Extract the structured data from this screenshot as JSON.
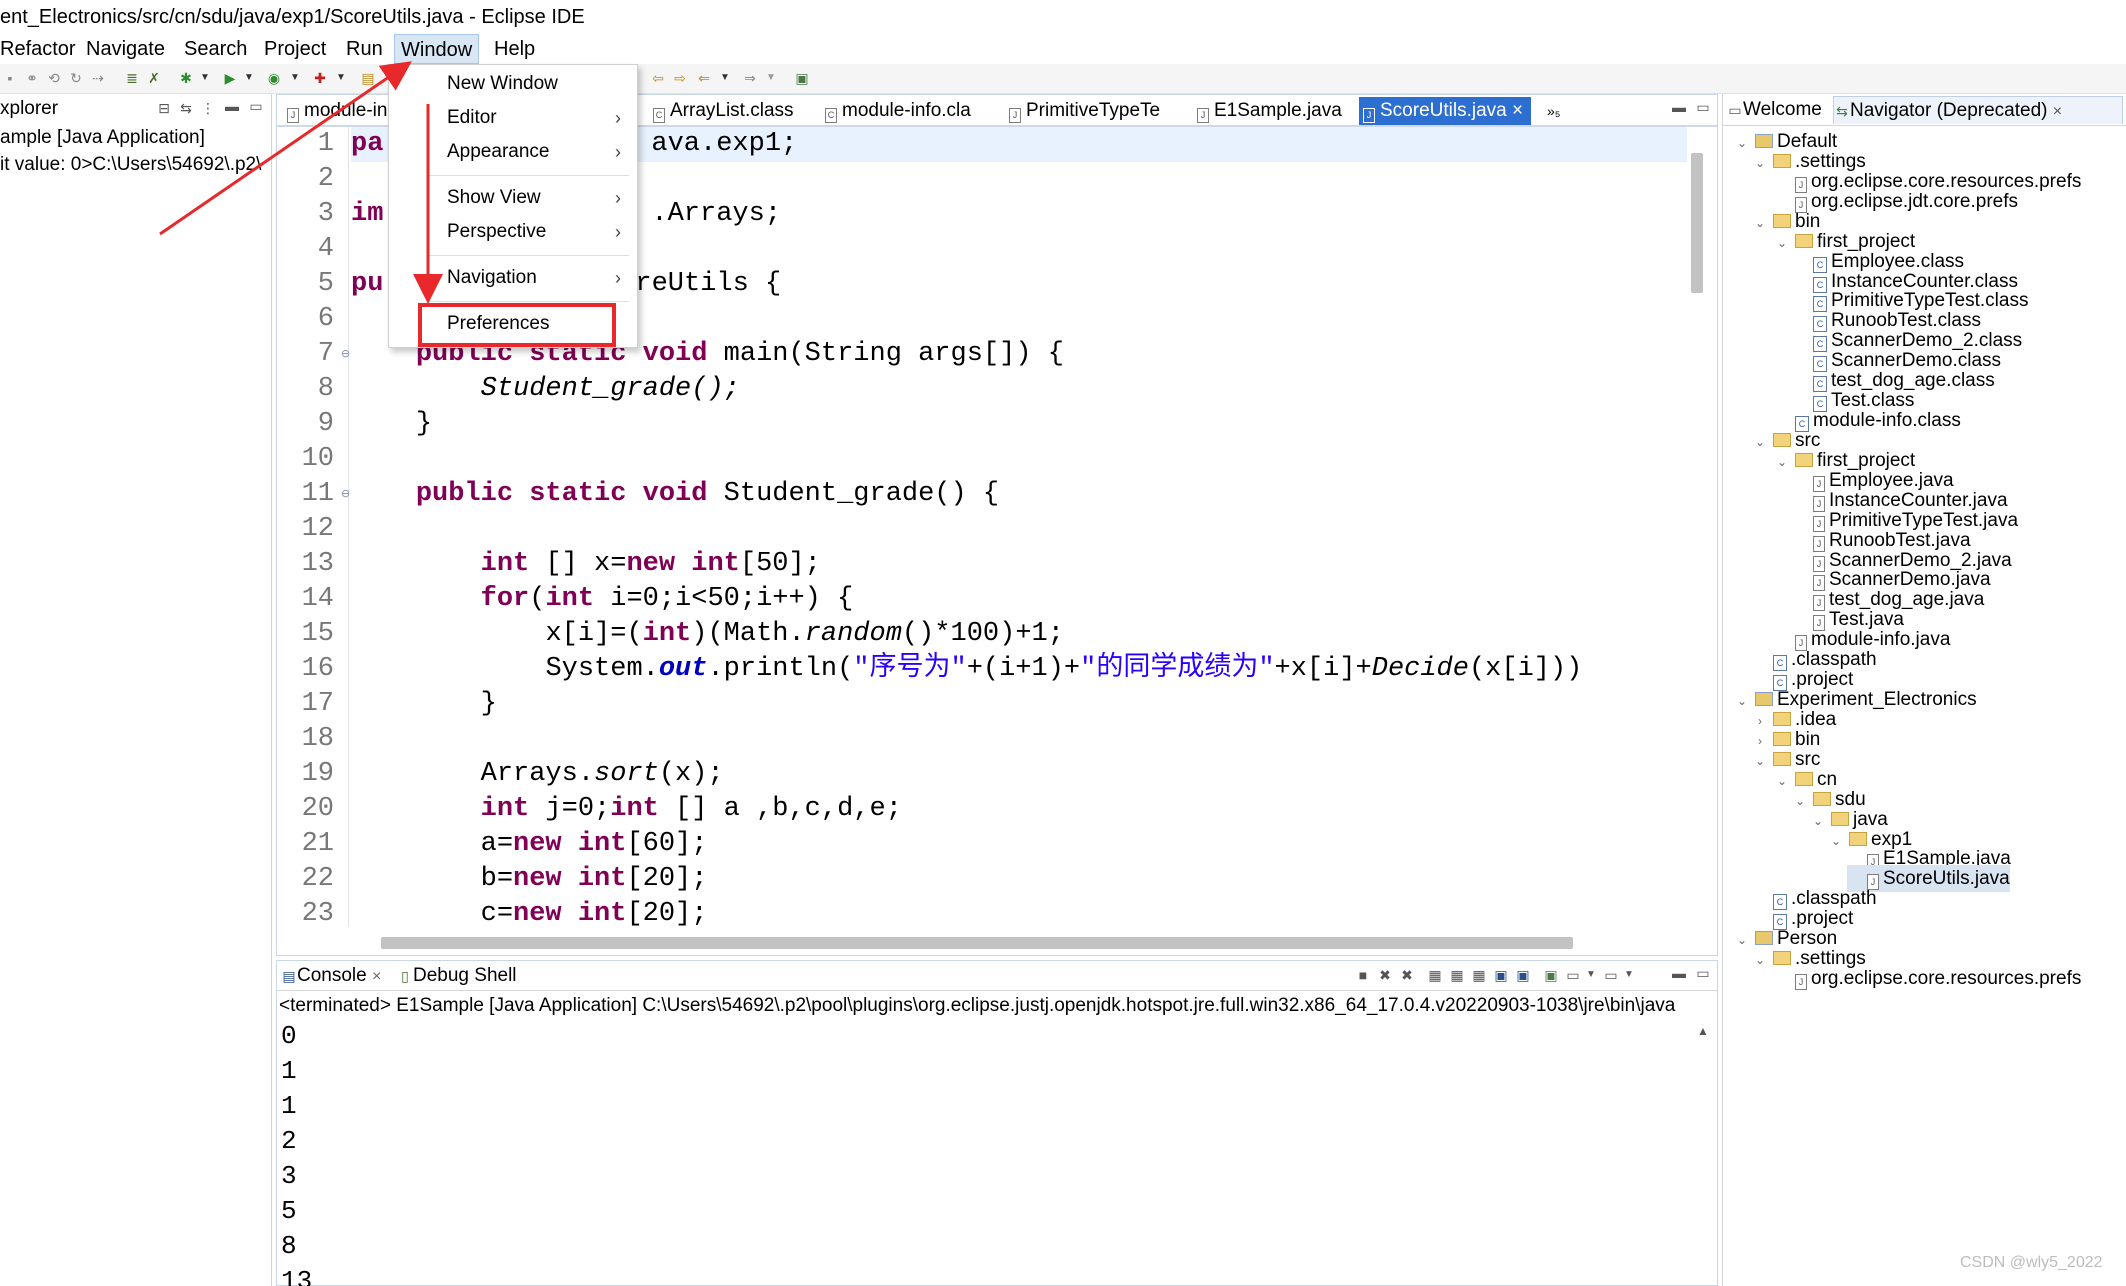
{
  "window": {
    "title": "ent_Electronics/src/cn/sdu/java/exp1/ScoreUtils.java - Eclipse IDE"
  },
  "menubar": {
    "items": [
      "Refactor",
      "Navigate",
      "Search",
      "Project",
      "Run",
      "Window",
      "Help"
    ],
    "active": "Window"
  },
  "window_menu": {
    "items": [
      {
        "label": "New Window",
        "chevron": ""
      },
      {
        "label": "Editor",
        "chevron": "›"
      },
      {
        "label": "Appearance",
        "chevron": "›"
      },
      {
        "label": "Show View",
        "chevron": "›"
      },
      {
        "label": "Perspective",
        "chevron": "›"
      },
      {
        "label": "Navigation",
        "chevron": "›"
      },
      {
        "label": "Preferences",
        "chevron": ""
      }
    ],
    "highlighted": "Preferences"
  },
  "left_pane": {
    "title": "xplorer",
    "rows": [
      "ample [Java Application]",
      "it value: 0>C:\\Users\\54692\\.p2\\"
    ]
  },
  "editor": {
    "tabs": [
      {
        "label": "module-in",
        "icon": "J",
        "active": false
      },
      {
        "label": "ArrayList.class",
        "icon": "C",
        "active": false
      },
      {
        "label": "module-info.cla",
        "icon": "C",
        "active": false
      },
      {
        "label": "PrimitiveTypeTe",
        "icon": "J",
        "active": false
      },
      {
        "label": "E1Sample.java",
        "icon": "J",
        "active": false
      },
      {
        "label": "ScoreUtils.java",
        "icon": "J",
        "active": true
      }
    ],
    "overflow_label": "»₅",
    "close_glyph": "×",
    "line_numbers": [
      "1",
      "2",
      "3",
      "4",
      "5",
      "6",
      "7",
      "8",
      "9",
      "10",
      "11",
      "12",
      "13",
      "14",
      "15",
      "16",
      "17",
      "18",
      "19",
      "20",
      "21",
      "22",
      "23"
    ],
    "lines": {
      "l1": {
        "kw": "pa",
        "rest": "ava.exp1;"
      },
      "l3": {
        "kw": "im",
        "rest": ".Arrays;"
      },
      "l5": {
        "kw": "pu",
        "rest": "reUtils {"
      },
      "l7": {
        "kw": "public static void",
        "rest": " main(String args[]) {"
      },
      "l8": "Student_grade();",
      "l9": "}",
      "l11": {
        "kw": "public static void",
        "rest": " Student_grade() {"
      },
      "l13": {
        "kw1": "int",
        "m1": " [] x=",
        "kw2": "new",
        "m2": " ",
        "kw3": "int",
        "rest": "[50];"
      },
      "l14": {
        "kw1": "for",
        "m1": "(",
        "kw2": "int",
        "rest": " i=0;i<50;i++) {"
      },
      "l15": {
        "a": "x[i]=(",
        "kw": "int",
        "b": ")(Math.",
        "it": "random",
        "c": "()*100)+1;"
      },
      "l16": {
        "a": "System.",
        "fld": "out",
        "b": ".println(",
        "s1": "\"序号为\"",
        "c": "+(i+1)+",
        "s2": "\"的同学成绩为\"",
        "d": "+x[i]+",
        "it": "Decide",
        "e": "(x[i]))"
      },
      "l17": "}",
      "l19": {
        "a": "Arrays.",
        "it": "sort",
        "b": "(x);"
      },
      "l20": {
        "kw1": "int",
        "m1": " j=0;",
        "kw2": "int",
        "rest": " [] a ,b,c,d,e;"
      },
      "l21": {
        "a": "a=",
        "kw1": "new",
        "m": " ",
        "kw2": "int",
        "rest": "[60];"
      },
      "l22": {
        "a": "b=",
        "kw1": "new",
        "m": " ",
        "kw2": "int",
        "rest": "[20];"
      },
      "l23": {
        "a": "c=",
        "kw1": "new",
        "m": " ",
        "kw2": "int",
        "rest": "[20];"
      }
    }
  },
  "console": {
    "tabs": [
      "Console",
      "Debug Shell"
    ],
    "close_glyph": "×",
    "terminated": "<terminated> E1Sample [Java Application] C:\\Users\\54692\\.p2\\pool\\plugins\\org.eclipse.justj.openjdk.hotspot.jre.full.win32.x86_64_17.0.4.v20220903-1038\\jre\\bin\\java",
    "output": [
      "0",
      "1",
      "1",
      "2",
      "3",
      "5",
      "8",
      "13"
    ]
  },
  "navigator": {
    "tabs": [
      "Welcome",
      "Navigator (Deprecated)"
    ],
    "close_glyph": "×",
    "tree": [
      {
        "label": "Default",
        "arrow": "⌄",
        "icon": "proj"
      },
      {
        "label": ".settings",
        "arrow": "⌄",
        "icon": "folder"
      },
      {
        "label": "org.eclipse.core.resources.prefs",
        "arrow": "",
        "icon": "file"
      },
      {
        "label": "org.eclipse.jdt.core.prefs",
        "arrow": "",
        "icon": "file"
      },
      {
        "label": "bin",
        "arrow": "⌄",
        "icon": "folder"
      },
      {
        "label": "first_project",
        "arrow": "⌄",
        "icon": "folder"
      },
      {
        "label": "Employee.class",
        "arrow": "",
        "icon": "cls"
      },
      {
        "label": "InstanceCounter.class",
        "arrow": "",
        "icon": "cls"
      },
      {
        "label": "PrimitiveTypeTest.class",
        "arrow": "",
        "icon": "cls"
      },
      {
        "label": "RunoobTest.class",
        "arrow": "",
        "icon": "cls"
      },
      {
        "label": "ScannerDemo_2.class",
        "arrow": "",
        "icon": "cls"
      },
      {
        "label": "ScannerDemo.class",
        "arrow": "",
        "icon": "cls"
      },
      {
        "label": "test_dog_age.class",
        "arrow": "",
        "icon": "cls"
      },
      {
        "label": "Test.class",
        "arrow": "",
        "icon": "cls"
      },
      {
        "label": "module-info.class",
        "arrow": "",
        "icon": "cls"
      },
      {
        "label": "src",
        "arrow": "⌄",
        "icon": "folder"
      },
      {
        "label": "first_project",
        "arrow": "⌄",
        "icon": "folder"
      },
      {
        "label": "Employee.java",
        "arrow": "",
        "icon": "file"
      },
      {
        "label": "InstanceCounter.java",
        "arrow": "",
        "icon": "file"
      },
      {
        "label": "PrimitiveTypeTest.java",
        "arrow": "",
        "icon": "file"
      },
      {
        "label": "RunoobTest.java",
        "arrow": "",
        "icon": "file"
      },
      {
        "label": "ScannerDemo_2.java",
        "arrow": "",
        "icon": "file"
      },
      {
        "label": "ScannerDemo.java",
        "arrow": "",
        "icon": "file"
      },
      {
        "label": "test_dog_age.java",
        "arrow": "",
        "icon": "file"
      },
      {
        "label": "Test.java",
        "arrow": "",
        "icon": "file"
      },
      {
        "label": "module-info.java",
        "arrow": "",
        "icon": "file"
      },
      {
        "label": ".classpath",
        "arrow": "",
        "icon": "cls"
      },
      {
        "label": ".project",
        "arrow": "",
        "icon": "cls"
      },
      {
        "label": "Experiment_Electronics",
        "arrow": "⌄",
        "icon": "proj"
      },
      {
        "label": ".idea",
        "arrow": "›",
        "icon": "folder"
      },
      {
        "label": "bin",
        "arrow": "›",
        "icon": "folder"
      },
      {
        "label": "src",
        "arrow": "⌄",
        "icon": "folder"
      },
      {
        "label": "cn",
        "arrow": "⌄",
        "icon": "folder"
      },
      {
        "label": "sdu",
        "arrow": "⌄",
        "icon": "folder"
      },
      {
        "label": "java",
        "arrow": "⌄",
        "icon": "folder"
      },
      {
        "label": "exp1",
        "arrow": "⌄",
        "icon": "folder"
      },
      {
        "label": "E1Sample.java",
        "arrow": "",
        "icon": "file"
      },
      {
        "label": "ScoreUtils.java",
        "arrow": "",
        "icon": "file",
        "selected": true
      },
      {
        "label": ".classpath",
        "arrow": "",
        "icon": "cls"
      },
      {
        "label": ".project",
        "arrow": "",
        "icon": "cls"
      },
      {
        "label": "Person",
        "arrow": "⌄",
        "icon": "proj"
      },
      {
        "label": ".settings",
        "arrow": "⌄",
        "icon": "folder"
      },
      {
        "label": "org.eclipse.core.resources.prefs",
        "arrow": "",
        "icon": "file"
      }
    ]
  },
  "annotations": {
    "highlight_color": "#e8282a",
    "arrow_color": "#e8282a"
  },
  "watermark": "CSDN @wly5_2022"
}
